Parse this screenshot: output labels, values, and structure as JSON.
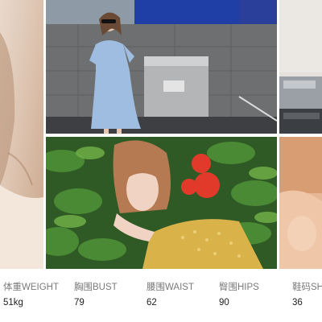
{
  "gallery": {
    "photos": [
      {
        "label": "left portrait crop"
      },
      {
        "label": "woman in light blue dress by stone wall"
      },
      {
        "label": "woman in yellow top among red flowers and leaves"
      },
      {
        "label": "right top interior crop"
      },
      {
        "label": "right bottom warm portrait crop"
      }
    ]
  },
  "measurements": [
    {
      "label": "体重WEIGHT",
      "value": "51kg"
    },
    {
      "label": "胸围BUST",
      "value": "79"
    },
    {
      "label": "腰围WAIST",
      "value": "62"
    },
    {
      "label": "臀围HIPS",
      "value": "90"
    },
    {
      "label": "鞋码SH",
      "value": "36"
    }
  ]
}
